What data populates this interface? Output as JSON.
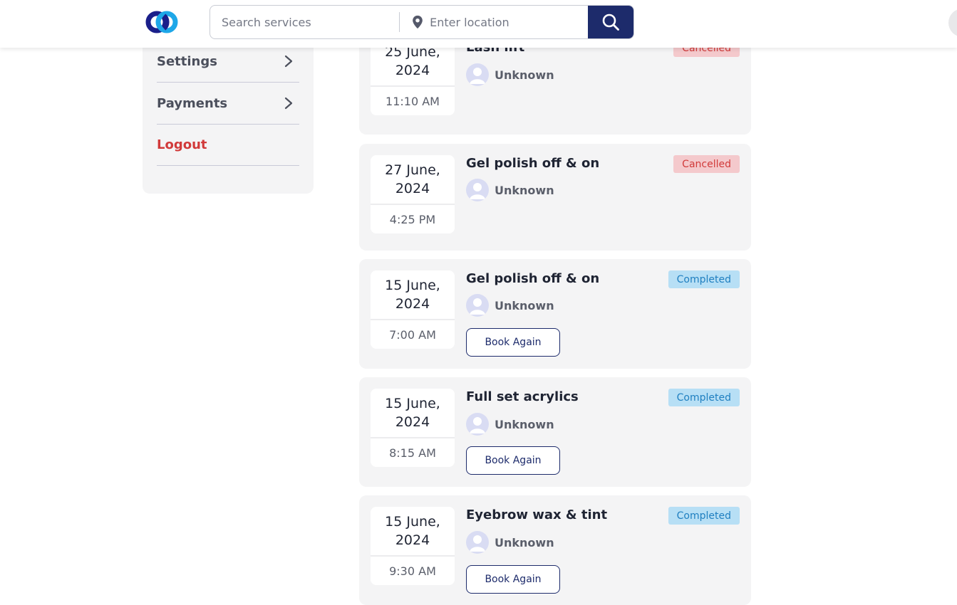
{
  "header": {
    "search_placeholder": "Search services",
    "location_placeholder": "Enter location"
  },
  "sidebar": {
    "items": [
      {
        "label": "Settings"
      },
      {
        "label": "Payments"
      },
      {
        "label": "Logout"
      }
    ]
  },
  "bookings": [
    {
      "date": "25 June, 2024",
      "time": "11:10 AM",
      "service": "Lash lift",
      "staff": "Unknown",
      "status": "Cancelled"
    },
    {
      "date": "27 June, 2024",
      "time": "4:25 PM",
      "service": "Gel polish off & on",
      "staff": "Unknown",
      "status": "Cancelled"
    },
    {
      "date": "15 June, 2024",
      "time": "7:00 AM",
      "service": "Gel polish off & on",
      "staff": "Unknown",
      "status": "Completed",
      "action": "Book Again"
    },
    {
      "date": "15 June, 2024",
      "time": "8:15 AM",
      "service": "Full set acrylics",
      "staff": "Unknown",
      "status": "Completed",
      "action": "Book Again"
    },
    {
      "date": "15 June, 2024",
      "time": "9:30 AM",
      "service": "Eyebrow wax & tint",
      "staff": "Unknown",
      "status": "Completed",
      "action": "Book Again"
    }
  ],
  "colors": {
    "brand_navy": "#1d2b6b",
    "brand_blue": "#1ea7e8",
    "cancelled": "#d13a3a",
    "completed": "#1f7fc0"
  }
}
